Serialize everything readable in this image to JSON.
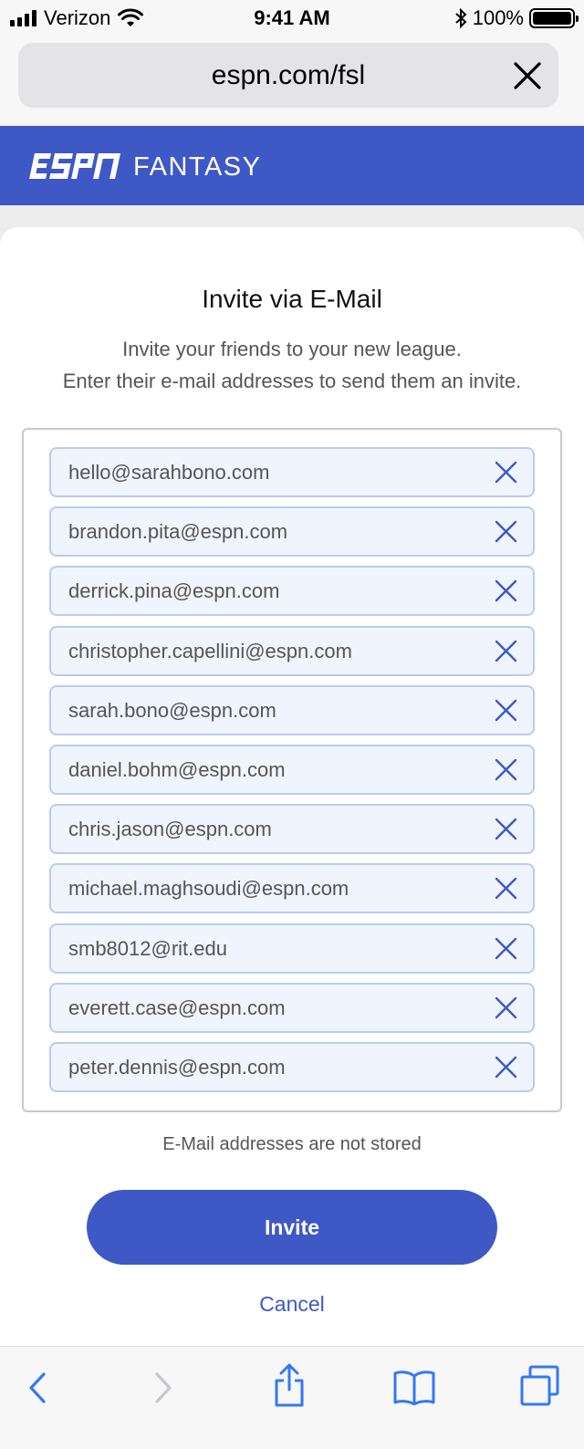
{
  "status_bar": {
    "carrier": "Verizon",
    "time": "9:41 AM",
    "battery": "100%"
  },
  "browser": {
    "url": "espn.com/fsl"
  },
  "header": {
    "brand": "ESPN",
    "product": "FANTASY",
    "color": "#3e58c6"
  },
  "invite": {
    "title": "Invite via E-Mail",
    "subtitle_line1": "Invite your friends to your new league.",
    "subtitle_line2": "Enter their e-mail addresses to send them an invite.",
    "emails": [
      "hello@sarahbono.com",
      "brandon.pita@espn.com",
      "derrick.pina@espn.com",
      "christopher.capellini@espn.com",
      "sarah.bono@espn.com",
      "daniel.bohm@espn.com",
      "chris.jason@espn.com",
      "michael.maghsoudi@espn.com",
      "smb8012@rit.edu",
      "everett.case@espn.com",
      "peter.dennis@espn.com"
    ],
    "note": "E-Mail addresses are not stored",
    "invite_label": "Invite",
    "cancel_label": "Cancel"
  },
  "icons": {
    "url_close": "close-icon",
    "chip_remove": "close-icon",
    "toolbar": [
      "back-icon",
      "forward-icon",
      "share-icon",
      "bookmarks-icon",
      "tabs-icon"
    ]
  }
}
